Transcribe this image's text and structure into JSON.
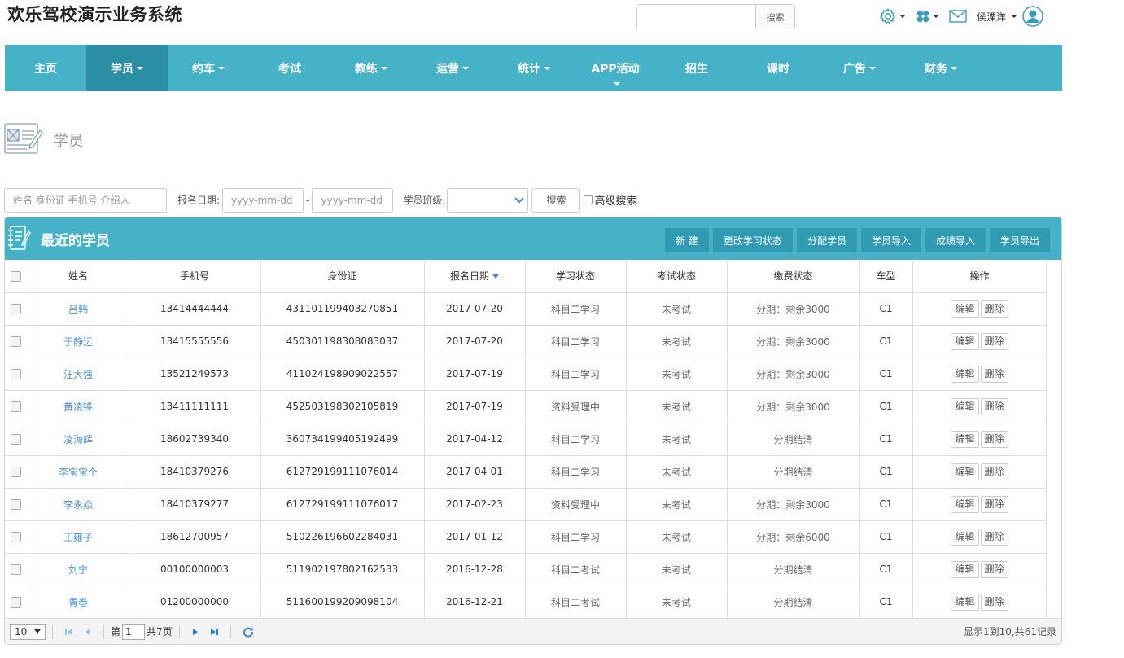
{
  "app_title": "欢乐驾校演示业务系统",
  "top_search": {
    "placeholder": "",
    "button": "搜索"
  },
  "user": {
    "name": "侯溧洋"
  },
  "nav": [
    {
      "label": "主页",
      "caret": false
    },
    {
      "label": "学员",
      "caret": true
    },
    {
      "label": "约车",
      "caret": true
    },
    {
      "label": "考试",
      "caret": false
    },
    {
      "label": "教练",
      "caret": true
    },
    {
      "label": "运营",
      "caret": true
    },
    {
      "label": "统计",
      "caret": true
    },
    {
      "label": "APP活动",
      "caret": false
    },
    {
      "label": "招生",
      "caret": false
    },
    {
      "label": "课时",
      "caret": false
    },
    {
      "label": "广告",
      "caret": true
    },
    {
      "label": "财务",
      "caret": true
    }
  ],
  "nav_active_index": 1,
  "page_heading": "学员",
  "filter": {
    "keyword_placeholder": "姓名 身份证 手机号 介绍人",
    "date_label": "报名日期:",
    "date_from_placeholder": "yyyy-mm-dd",
    "date_sep": "-",
    "date_to_placeholder": "yyyy-mm-dd",
    "class_label": "学员班级:",
    "class_value": "",
    "search_button": "搜索",
    "advanced_label": "高级搜索"
  },
  "panel": {
    "title": "最近的学员",
    "actions": [
      "新 建",
      "更改学习状态",
      "分配学员",
      "学员导入",
      "成绩导入",
      "学员导出"
    ]
  },
  "table": {
    "columns": [
      "姓名",
      "手机号",
      "身份证",
      "报名日期",
      "学习状态",
      "考试状态",
      "缴费状态",
      "车型",
      "操作"
    ],
    "edit_label": "编辑",
    "delete_label": "删除",
    "rows": [
      [
        "吕韩",
        "13414444444",
        "431101199403270851",
        "2017-07-20",
        "科目二学习",
        "未考试",
        "分期：剩余3000",
        "C1"
      ],
      [
        "于静远",
        "13415555556",
        "450301198308083037",
        "2017-07-20",
        "科目二学习",
        "未考试",
        "分期：剩余3000",
        "C1"
      ],
      [
        "汪大强",
        "13521249573",
        "411024198909022557",
        "2017-07-19",
        "科目二学习",
        "未考试",
        "分期：剩余3000",
        "C1"
      ],
      [
        "黄凌锋",
        "13411111111",
        "452503198302105819",
        "2017-07-19",
        "资料受理中",
        "未考试",
        "分期：剩余3000",
        "C1"
      ],
      [
        "凌海辉",
        "18602739340",
        "360734199405192499",
        "2017-04-12",
        "科目二学习",
        "未考试",
        "分期结清",
        "C1"
      ],
      [
        "李宝宝个",
        "18410379276",
        "612729199111076014",
        "2017-04-01",
        "科目二学习",
        "未考试",
        "分期结清",
        "C1"
      ],
      [
        "李永焱",
        "18410379277",
        "612729199111076017",
        "2017-02-23",
        "资料受理中",
        "未考试",
        "分期：剩余3000",
        "C1"
      ],
      [
        "王雍子",
        "18612700957",
        "510226196602284031",
        "2017-01-12",
        "科目二学习",
        "未考试",
        "分期：剩余6000",
        "C1"
      ],
      [
        "刘宁",
        "00100000003",
        "511902197802162533",
        "2016-12-28",
        "科目二考试",
        "未考试",
        "分期结清",
        "C1"
      ],
      [
        "青春",
        "01200000000",
        "511600199209098104",
        "2016-12-21",
        "科目二考试",
        "未考试",
        "分期结清",
        "C1"
      ]
    ]
  },
  "pager": {
    "page_size": "10",
    "page_prefix": "第",
    "page_value": "1",
    "page_suffix": "共7页",
    "info": "显示1到10,共61记录"
  },
  "colors": {
    "nav_bg": "#46b2c8",
    "nav_active": "#2a8ea4",
    "action_btn": "#2f9ab1",
    "link": "#4a90c8"
  }
}
